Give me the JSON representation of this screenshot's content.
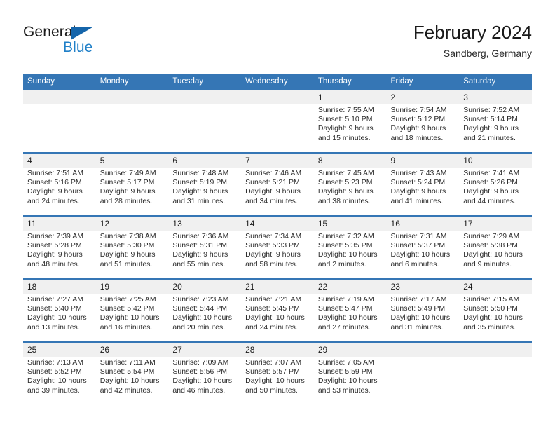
{
  "brand": {
    "name_part1": "General",
    "name_part2": "Blue",
    "accent_color": "#2080c8",
    "triangle_color": "#1565aa"
  },
  "header": {
    "month_title": "February 2024",
    "location": "Sandberg, Germany"
  },
  "theme": {
    "header_blue": "#3576b5",
    "daynum_band": "#f0f0f0"
  },
  "weekday_headers": [
    "Sunday",
    "Monday",
    "Tuesday",
    "Wednesday",
    "Thursday",
    "Friday",
    "Saturday"
  ],
  "weeks": [
    [
      {
        "day": "",
        "sunrise": "",
        "sunset": "",
        "daylight_line1": "",
        "daylight_line2": ""
      },
      {
        "day": "",
        "sunrise": "",
        "sunset": "",
        "daylight_line1": "",
        "daylight_line2": ""
      },
      {
        "day": "",
        "sunrise": "",
        "sunset": "",
        "daylight_line1": "",
        "daylight_line2": ""
      },
      {
        "day": "",
        "sunrise": "",
        "sunset": "",
        "daylight_line1": "",
        "daylight_line2": ""
      },
      {
        "day": "1",
        "sunrise": "Sunrise: 7:55 AM",
        "sunset": "Sunset: 5:10 PM",
        "daylight_line1": "Daylight: 9 hours",
        "daylight_line2": "and 15 minutes."
      },
      {
        "day": "2",
        "sunrise": "Sunrise: 7:54 AM",
        "sunset": "Sunset: 5:12 PM",
        "daylight_line1": "Daylight: 9 hours",
        "daylight_line2": "and 18 minutes."
      },
      {
        "day": "3",
        "sunrise": "Sunrise: 7:52 AM",
        "sunset": "Sunset: 5:14 PM",
        "daylight_line1": "Daylight: 9 hours",
        "daylight_line2": "and 21 minutes."
      }
    ],
    [
      {
        "day": "4",
        "sunrise": "Sunrise: 7:51 AM",
        "sunset": "Sunset: 5:16 PM",
        "daylight_line1": "Daylight: 9 hours",
        "daylight_line2": "and 24 minutes."
      },
      {
        "day": "5",
        "sunrise": "Sunrise: 7:49 AM",
        "sunset": "Sunset: 5:17 PM",
        "daylight_line1": "Daylight: 9 hours",
        "daylight_line2": "and 28 minutes."
      },
      {
        "day": "6",
        "sunrise": "Sunrise: 7:48 AM",
        "sunset": "Sunset: 5:19 PM",
        "daylight_line1": "Daylight: 9 hours",
        "daylight_line2": "and 31 minutes."
      },
      {
        "day": "7",
        "sunrise": "Sunrise: 7:46 AM",
        "sunset": "Sunset: 5:21 PM",
        "daylight_line1": "Daylight: 9 hours",
        "daylight_line2": "and 34 minutes."
      },
      {
        "day": "8",
        "sunrise": "Sunrise: 7:45 AM",
        "sunset": "Sunset: 5:23 PM",
        "daylight_line1": "Daylight: 9 hours",
        "daylight_line2": "and 38 minutes."
      },
      {
        "day": "9",
        "sunrise": "Sunrise: 7:43 AM",
        "sunset": "Sunset: 5:24 PM",
        "daylight_line1": "Daylight: 9 hours",
        "daylight_line2": "and 41 minutes."
      },
      {
        "day": "10",
        "sunrise": "Sunrise: 7:41 AM",
        "sunset": "Sunset: 5:26 PM",
        "daylight_line1": "Daylight: 9 hours",
        "daylight_line2": "and 44 minutes."
      }
    ],
    [
      {
        "day": "11",
        "sunrise": "Sunrise: 7:39 AM",
        "sunset": "Sunset: 5:28 PM",
        "daylight_line1": "Daylight: 9 hours",
        "daylight_line2": "and 48 minutes."
      },
      {
        "day": "12",
        "sunrise": "Sunrise: 7:38 AM",
        "sunset": "Sunset: 5:30 PM",
        "daylight_line1": "Daylight: 9 hours",
        "daylight_line2": "and 51 minutes."
      },
      {
        "day": "13",
        "sunrise": "Sunrise: 7:36 AM",
        "sunset": "Sunset: 5:31 PM",
        "daylight_line1": "Daylight: 9 hours",
        "daylight_line2": "and 55 minutes."
      },
      {
        "day": "14",
        "sunrise": "Sunrise: 7:34 AM",
        "sunset": "Sunset: 5:33 PM",
        "daylight_line1": "Daylight: 9 hours",
        "daylight_line2": "and 58 minutes."
      },
      {
        "day": "15",
        "sunrise": "Sunrise: 7:32 AM",
        "sunset": "Sunset: 5:35 PM",
        "daylight_line1": "Daylight: 10 hours",
        "daylight_line2": "and 2 minutes."
      },
      {
        "day": "16",
        "sunrise": "Sunrise: 7:31 AM",
        "sunset": "Sunset: 5:37 PM",
        "daylight_line1": "Daylight: 10 hours",
        "daylight_line2": "and 6 minutes."
      },
      {
        "day": "17",
        "sunrise": "Sunrise: 7:29 AM",
        "sunset": "Sunset: 5:38 PM",
        "daylight_line1": "Daylight: 10 hours",
        "daylight_line2": "and 9 minutes."
      }
    ],
    [
      {
        "day": "18",
        "sunrise": "Sunrise: 7:27 AM",
        "sunset": "Sunset: 5:40 PM",
        "daylight_line1": "Daylight: 10 hours",
        "daylight_line2": "and 13 minutes."
      },
      {
        "day": "19",
        "sunrise": "Sunrise: 7:25 AM",
        "sunset": "Sunset: 5:42 PM",
        "daylight_line1": "Daylight: 10 hours",
        "daylight_line2": "and 16 minutes."
      },
      {
        "day": "20",
        "sunrise": "Sunrise: 7:23 AM",
        "sunset": "Sunset: 5:44 PM",
        "daylight_line1": "Daylight: 10 hours",
        "daylight_line2": "and 20 minutes."
      },
      {
        "day": "21",
        "sunrise": "Sunrise: 7:21 AM",
        "sunset": "Sunset: 5:45 PM",
        "daylight_line1": "Daylight: 10 hours",
        "daylight_line2": "and 24 minutes."
      },
      {
        "day": "22",
        "sunrise": "Sunrise: 7:19 AM",
        "sunset": "Sunset: 5:47 PM",
        "daylight_line1": "Daylight: 10 hours",
        "daylight_line2": "and 27 minutes."
      },
      {
        "day": "23",
        "sunrise": "Sunrise: 7:17 AM",
        "sunset": "Sunset: 5:49 PM",
        "daylight_line1": "Daylight: 10 hours",
        "daylight_line2": "and 31 minutes."
      },
      {
        "day": "24",
        "sunrise": "Sunrise: 7:15 AM",
        "sunset": "Sunset: 5:50 PM",
        "daylight_line1": "Daylight: 10 hours",
        "daylight_line2": "and 35 minutes."
      }
    ],
    [
      {
        "day": "25",
        "sunrise": "Sunrise: 7:13 AM",
        "sunset": "Sunset: 5:52 PM",
        "daylight_line1": "Daylight: 10 hours",
        "daylight_line2": "and 39 minutes."
      },
      {
        "day": "26",
        "sunrise": "Sunrise: 7:11 AM",
        "sunset": "Sunset: 5:54 PM",
        "daylight_line1": "Daylight: 10 hours",
        "daylight_line2": "and 42 minutes."
      },
      {
        "day": "27",
        "sunrise": "Sunrise: 7:09 AM",
        "sunset": "Sunset: 5:56 PM",
        "daylight_line1": "Daylight: 10 hours",
        "daylight_line2": "and 46 minutes."
      },
      {
        "day": "28",
        "sunrise": "Sunrise: 7:07 AM",
        "sunset": "Sunset: 5:57 PM",
        "daylight_line1": "Daylight: 10 hours",
        "daylight_line2": "and 50 minutes."
      },
      {
        "day": "29",
        "sunrise": "Sunrise: 7:05 AM",
        "sunset": "Sunset: 5:59 PM",
        "daylight_line1": "Daylight: 10 hours",
        "daylight_line2": "and 53 minutes."
      },
      {
        "day": "",
        "sunrise": "",
        "sunset": "",
        "daylight_line1": "",
        "daylight_line2": ""
      },
      {
        "day": "",
        "sunrise": "",
        "sunset": "",
        "daylight_line1": "",
        "daylight_line2": ""
      }
    ]
  ]
}
